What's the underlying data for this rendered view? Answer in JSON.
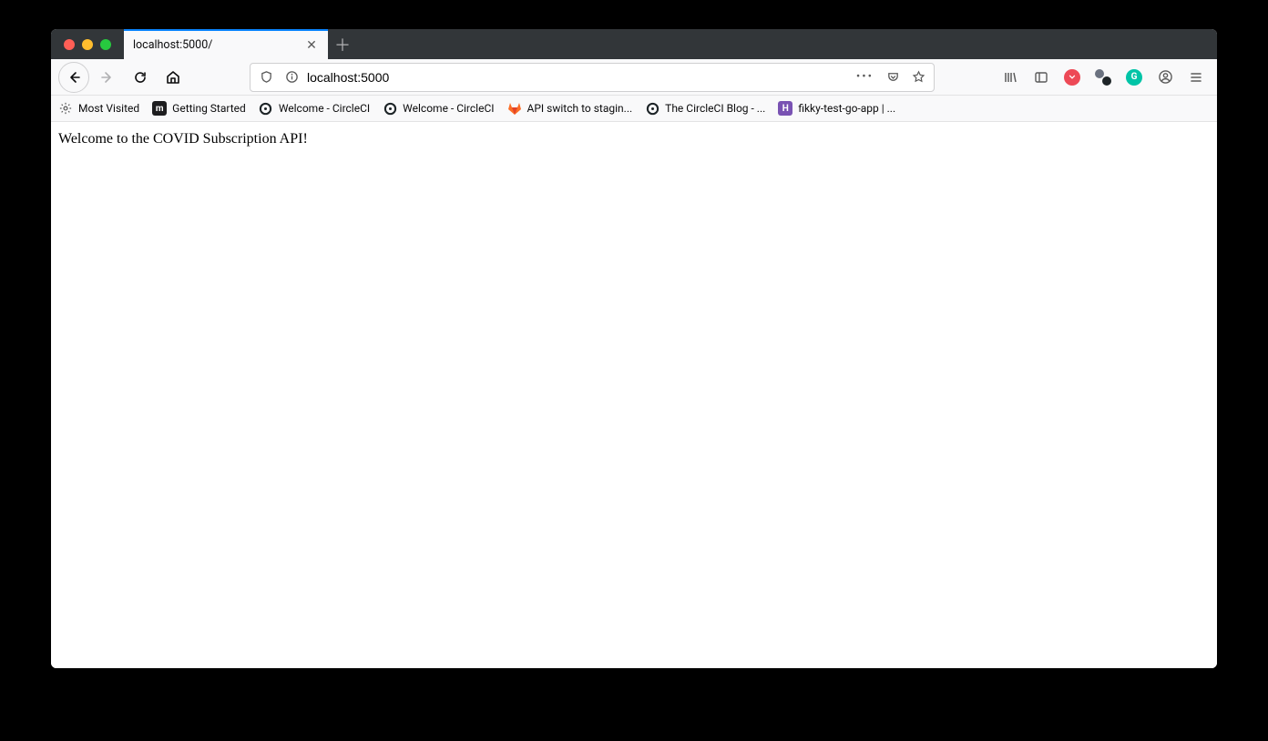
{
  "tab": {
    "title": "localhost:5000/"
  },
  "url": {
    "value": "localhost:5000"
  },
  "bookmarks": [
    {
      "label": "Most Visited",
      "icon": "gear"
    },
    {
      "label": "Getting Started",
      "icon": "m-square"
    },
    {
      "label": "Welcome - CircleCI",
      "icon": "circleci"
    },
    {
      "label": "Welcome - CircleCI",
      "icon": "circleci"
    },
    {
      "label": "API switch to stagin...",
      "icon": "gitlab"
    },
    {
      "label": "The CircleCI Blog - ...",
      "icon": "circleci"
    },
    {
      "label": "fikky-test-go-app | ...",
      "icon": "h-square"
    }
  ],
  "page": {
    "body": "Welcome to the COVID Subscription API!"
  }
}
